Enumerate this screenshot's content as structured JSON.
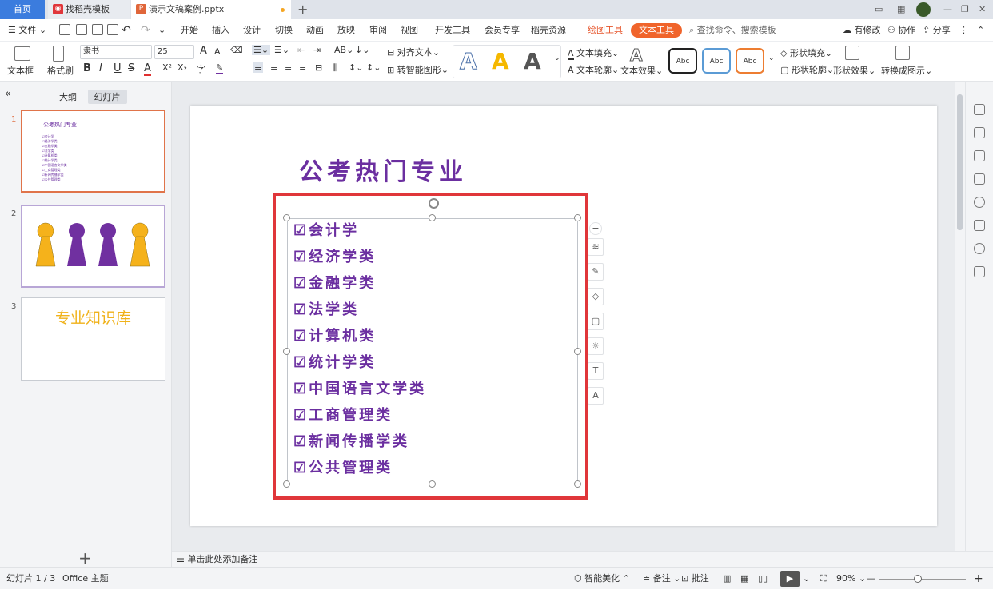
{
  "tabs": {
    "home": "首页",
    "template": "找稻壳模板",
    "doc": "演示文稿案例.pptx"
  },
  "menu": {
    "file": "文件",
    "items": [
      "开始",
      "插入",
      "设计",
      "切换",
      "动画",
      "放映",
      "审阅",
      "视图",
      "开发工具",
      "会员专享",
      "稻壳资源"
    ],
    "drawing_tools": "绘图工具",
    "text_tools": "文本工具",
    "search": "查找命令、搜索模板",
    "changes": "有修改",
    "collab": "协作",
    "share": "分享"
  },
  "ribbon": {
    "textbox": "文本框",
    "format_painter": "格式刷",
    "font": "隶书",
    "size": "25",
    "align_text": "对齐文本",
    "smart_shape": "转智能图形",
    "text_fill": "文本填充",
    "text_outline": "文本轮廓",
    "text_effect": "文本效果",
    "abc": "Abc",
    "shape_fill": "形状填充",
    "shape_outline": "形状轮廓",
    "shape_effect": "形状效果",
    "convert": "转换成图示",
    "bold": "B",
    "italic": "I",
    "underline": "U",
    "strike": "S",
    "fontcolor": "A",
    "grow": "A",
    "shrink": "A",
    "sup": "X²",
    "sub": "X₂",
    "wordart": "A"
  },
  "left_panel": {
    "outline_tab": "大纲",
    "slides_tab": "幻灯片",
    "add": "+",
    "slides": [
      {
        "num": "1"
      },
      {
        "num": "2"
      },
      {
        "num": "3",
        "title": "专业知识库"
      }
    ]
  },
  "slide": {
    "title": "公考热门专业",
    "items": [
      "☑会计学",
      "☑经济学类",
      "☑金融学类",
      "☑法学类",
      "☑计算机类",
      "☑统计学类",
      "☑中国语言文学类",
      "☑工商管理类",
      "☑新闻传播学类",
      "☑公共管理类"
    ]
  },
  "notes": "单击此处添加备注",
  "status": {
    "slide_count": "幻灯片 1 / 3",
    "theme": "Office 主题",
    "beautify": "智能美化",
    "notes": "备注",
    "comments": "批注",
    "zoom": "90%",
    "plus": "+"
  },
  "colors": {
    "title_purple": "#6b2fa0",
    "accent_orange": "#f0642b",
    "tab_blue": "#3b7cde",
    "selection_red": "#e0363a",
    "pawn_yellow": "#f5b21b",
    "pawn_purple": "#7030a0"
  }
}
